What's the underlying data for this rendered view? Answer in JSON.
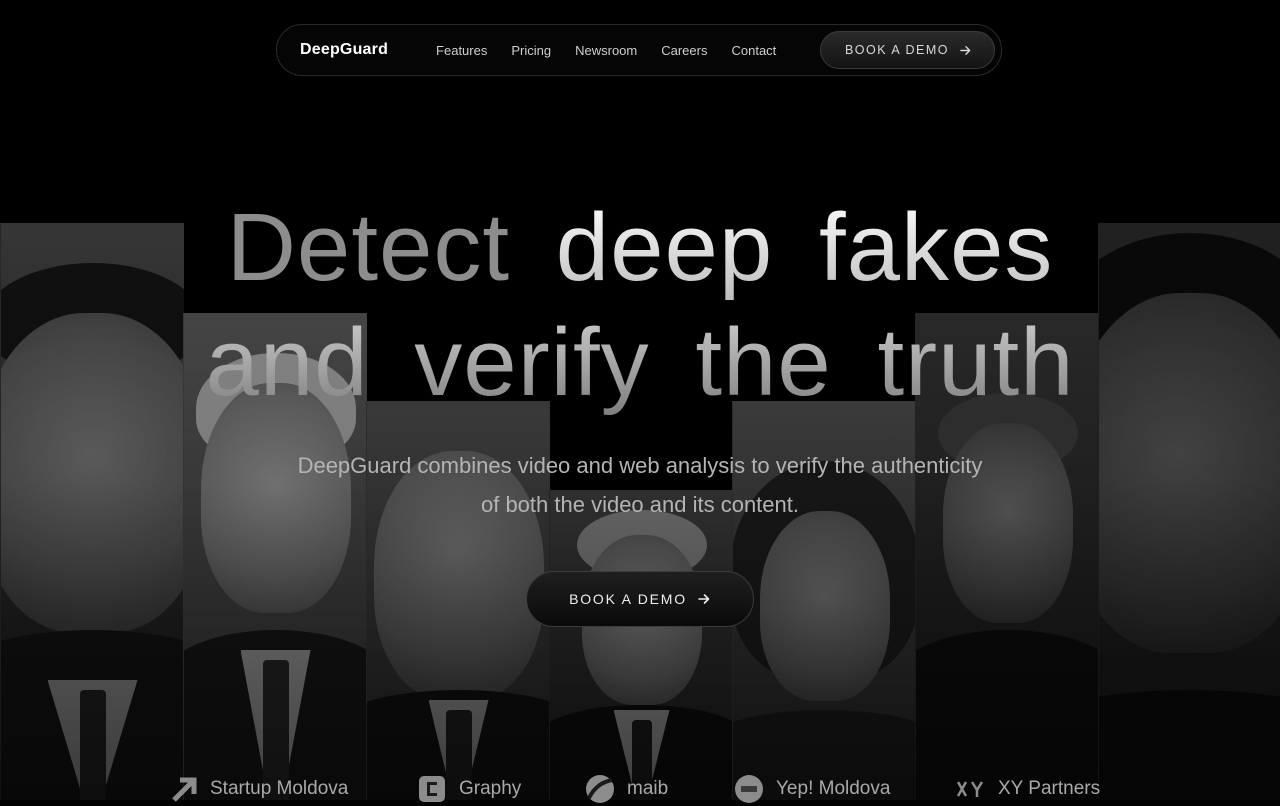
{
  "brand": "DeepGuard",
  "nav": {
    "links": [
      "Features",
      "Pricing",
      "Newsroom",
      "Careers",
      "Contact"
    ],
    "cta_label": "BOOK A DEMO"
  },
  "hero": {
    "line1": {
      "muted": "Detect",
      "bright_a": "deep",
      "bright_b": "fakes"
    },
    "line2": {
      "a": "and",
      "b": "verify",
      "c": "the",
      "d": "truth"
    },
    "subtitle_line1": "DeepGuard combines video and web analysis to verify the authenticity",
    "subtitle_line2": "of both the video and its content.",
    "cta_label": "BOOK A DEMO"
  },
  "partners": [
    "Startup Moldova",
    "Graphy",
    "maib",
    "Yep! Moldova",
    "XY Partners"
  ],
  "icons": {
    "arrow": "arrow-right-icon",
    "partner_logos": [
      "startup-moldova-logo-icon",
      "graphy-logo-icon",
      "maib-logo-icon",
      "yep-moldova-logo-icon",
      "xy-partners-logo-icon"
    ]
  },
  "colors": {
    "background": "#000000",
    "muted_text": "#8d8d8d",
    "subtitle": "#b4b4b4"
  }
}
